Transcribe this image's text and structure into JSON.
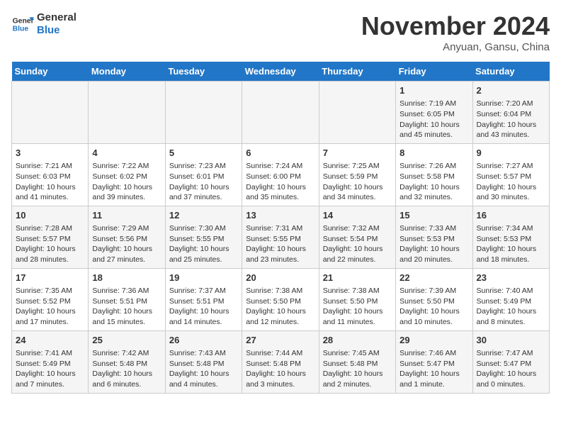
{
  "header": {
    "logo_line1": "General",
    "logo_line2": "Blue",
    "month": "November 2024",
    "location": "Anyuan, Gansu, China"
  },
  "weekdays": [
    "Sunday",
    "Monday",
    "Tuesday",
    "Wednesday",
    "Thursday",
    "Friday",
    "Saturday"
  ],
  "weeks": [
    [
      {
        "day": "",
        "info": ""
      },
      {
        "day": "",
        "info": ""
      },
      {
        "day": "",
        "info": ""
      },
      {
        "day": "",
        "info": ""
      },
      {
        "day": "",
        "info": ""
      },
      {
        "day": "1",
        "info": "Sunrise: 7:19 AM\nSunset: 6:05 PM\nDaylight: 10 hours and 45 minutes."
      },
      {
        "day": "2",
        "info": "Sunrise: 7:20 AM\nSunset: 6:04 PM\nDaylight: 10 hours and 43 minutes."
      }
    ],
    [
      {
        "day": "3",
        "info": "Sunrise: 7:21 AM\nSunset: 6:03 PM\nDaylight: 10 hours and 41 minutes."
      },
      {
        "day": "4",
        "info": "Sunrise: 7:22 AM\nSunset: 6:02 PM\nDaylight: 10 hours and 39 minutes."
      },
      {
        "day": "5",
        "info": "Sunrise: 7:23 AM\nSunset: 6:01 PM\nDaylight: 10 hours and 37 minutes."
      },
      {
        "day": "6",
        "info": "Sunrise: 7:24 AM\nSunset: 6:00 PM\nDaylight: 10 hours and 35 minutes."
      },
      {
        "day": "7",
        "info": "Sunrise: 7:25 AM\nSunset: 5:59 PM\nDaylight: 10 hours and 34 minutes."
      },
      {
        "day": "8",
        "info": "Sunrise: 7:26 AM\nSunset: 5:58 PM\nDaylight: 10 hours and 32 minutes."
      },
      {
        "day": "9",
        "info": "Sunrise: 7:27 AM\nSunset: 5:57 PM\nDaylight: 10 hours and 30 minutes."
      }
    ],
    [
      {
        "day": "10",
        "info": "Sunrise: 7:28 AM\nSunset: 5:57 PM\nDaylight: 10 hours and 28 minutes."
      },
      {
        "day": "11",
        "info": "Sunrise: 7:29 AM\nSunset: 5:56 PM\nDaylight: 10 hours and 27 minutes."
      },
      {
        "day": "12",
        "info": "Sunrise: 7:30 AM\nSunset: 5:55 PM\nDaylight: 10 hours and 25 minutes."
      },
      {
        "day": "13",
        "info": "Sunrise: 7:31 AM\nSunset: 5:55 PM\nDaylight: 10 hours and 23 minutes."
      },
      {
        "day": "14",
        "info": "Sunrise: 7:32 AM\nSunset: 5:54 PM\nDaylight: 10 hours and 22 minutes."
      },
      {
        "day": "15",
        "info": "Sunrise: 7:33 AM\nSunset: 5:53 PM\nDaylight: 10 hours and 20 minutes."
      },
      {
        "day": "16",
        "info": "Sunrise: 7:34 AM\nSunset: 5:53 PM\nDaylight: 10 hours and 18 minutes."
      }
    ],
    [
      {
        "day": "17",
        "info": "Sunrise: 7:35 AM\nSunset: 5:52 PM\nDaylight: 10 hours and 17 minutes."
      },
      {
        "day": "18",
        "info": "Sunrise: 7:36 AM\nSunset: 5:51 PM\nDaylight: 10 hours and 15 minutes."
      },
      {
        "day": "19",
        "info": "Sunrise: 7:37 AM\nSunset: 5:51 PM\nDaylight: 10 hours and 14 minutes."
      },
      {
        "day": "20",
        "info": "Sunrise: 7:38 AM\nSunset: 5:50 PM\nDaylight: 10 hours and 12 minutes."
      },
      {
        "day": "21",
        "info": "Sunrise: 7:38 AM\nSunset: 5:50 PM\nDaylight: 10 hours and 11 minutes."
      },
      {
        "day": "22",
        "info": "Sunrise: 7:39 AM\nSunset: 5:50 PM\nDaylight: 10 hours and 10 minutes."
      },
      {
        "day": "23",
        "info": "Sunrise: 7:40 AM\nSunset: 5:49 PM\nDaylight: 10 hours and 8 minutes."
      }
    ],
    [
      {
        "day": "24",
        "info": "Sunrise: 7:41 AM\nSunset: 5:49 PM\nDaylight: 10 hours and 7 minutes."
      },
      {
        "day": "25",
        "info": "Sunrise: 7:42 AM\nSunset: 5:48 PM\nDaylight: 10 hours and 6 minutes."
      },
      {
        "day": "26",
        "info": "Sunrise: 7:43 AM\nSunset: 5:48 PM\nDaylight: 10 hours and 4 minutes."
      },
      {
        "day": "27",
        "info": "Sunrise: 7:44 AM\nSunset: 5:48 PM\nDaylight: 10 hours and 3 minutes."
      },
      {
        "day": "28",
        "info": "Sunrise: 7:45 AM\nSunset: 5:48 PM\nDaylight: 10 hours and 2 minutes."
      },
      {
        "day": "29",
        "info": "Sunrise: 7:46 AM\nSunset: 5:47 PM\nDaylight: 10 hours and 1 minute."
      },
      {
        "day": "30",
        "info": "Sunrise: 7:47 AM\nSunset: 5:47 PM\nDaylight: 10 hours and 0 minutes."
      }
    ]
  ]
}
